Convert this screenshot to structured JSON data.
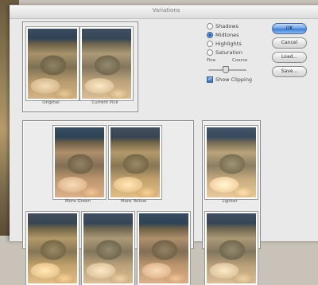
{
  "window": {
    "title": "Variations"
  },
  "original_panel": {
    "thumbs": [
      {
        "caption": "Original"
      },
      {
        "caption": "Current Pick"
      }
    ]
  },
  "options": {
    "radios": [
      {
        "label": "Shadows",
        "selected": false
      },
      {
        "label": "Midtones",
        "selected": true
      },
      {
        "label": "Highlights",
        "selected": false
      },
      {
        "label": "Saturation",
        "selected": false
      }
    ],
    "fine_label": "Fine",
    "coarse_label": "Coarse",
    "slider_level": 0.45,
    "show_clipping_label": "Show Clipping",
    "show_clipping_checked": true
  },
  "buttons": {
    "ok": "OK",
    "cancel": "Cancel",
    "load": "Load...",
    "save": "Save..."
  },
  "variations_panel": {
    "thumbs": [
      {
        "caption": "More Green"
      },
      {
        "caption": "More Yellow"
      }
    ]
  },
  "lightness_panel": {
    "thumbs": [
      {
        "caption": "Lighter"
      }
    ]
  }
}
